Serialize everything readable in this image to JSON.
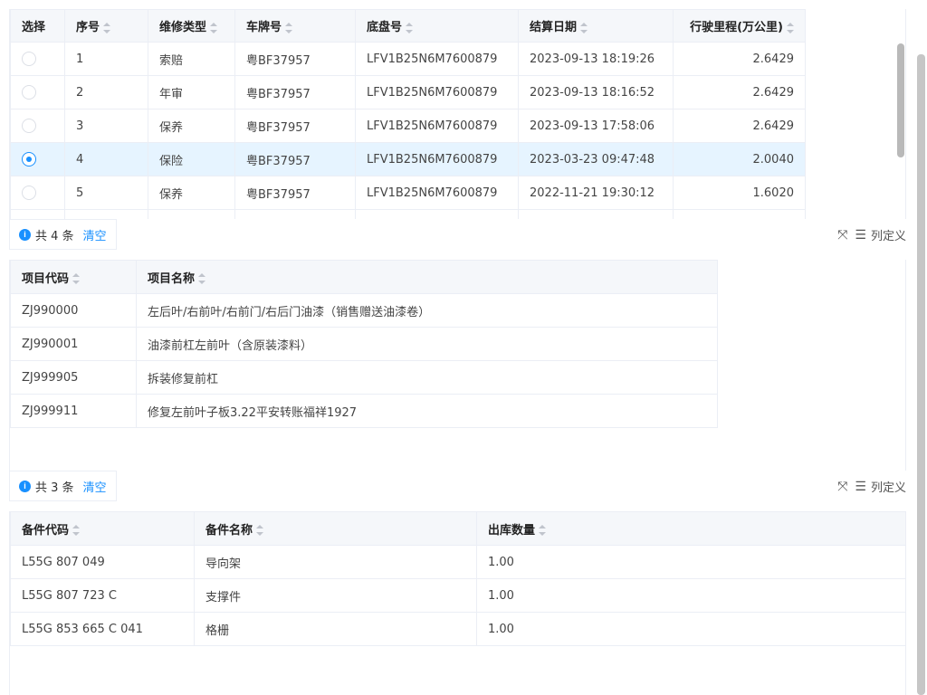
{
  "vehicle_table": {
    "headers": [
      "选择",
      "序号",
      "维修类型",
      "车牌号",
      "底盘号",
      "结算日期",
      "行驶里程(万公里)"
    ],
    "rows": [
      {
        "seq": "1",
        "type": "索赔",
        "plate": "粤BF37957",
        "vin": "LFV1B25N6M7600879",
        "date": "2023-09-13 18:19:26",
        "mileage": "2.6429",
        "selected": false
      },
      {
        "seq": "2",
        "type": "年审",
        "plate": "粤BF37957",
        "vin": "LFV1B25N6M7600879",
        "date": "2023-09-13 18:16:52",
        "mileage": "2.6429",
        "selected": false
      },
      {
        "seq": "3",
        "type": "保养",
        "plate": "粤BF37957",
        "vin": "LFV1B25N6M7600879",
        "date": "2023-09-13 17:58:06",
        "mileage": "2.6429",
        "selected": false
      },
      {
        "seq": "4",
        "type": "保险",
        "plate": "粤BF37957",
        "vin": "LFV1B25N6M7600879",
        "date": "2023-03-23 09:47:48",
        "mileage": "2.0040",
        "selected": true
      },
      {
        "seq": "5",
        "type": "保养",
        "plate": "粤BF37957",
        "vin": "LFV1B25N6M7600879",
        "date": "2022-11-21 19:30:12",
        "mileage": "1.6020",
        "selected": false
      }
    ]
  },
  "toolbar1": {
    "count": "共 4 条",
    "clear": "清空",
    "column_def": "列定义"
  },
  "project_table": {
    "headers": [
      "项目代码",
      "项目名称"
    ],
    "rows": [
      {
        "code": "ZJ990000",
        "name": "左后叶/右前叶/右前门/右后门油漆（销售赠送油漆卷）"
      },
      {
        "code": "ZJ990001",
        "name": "油漆前杠左前叶（含原装漆料）"
      },
      {
        "code": "ZJ999905",
        "name": "拆装修复前杠"
      },
      {
        "code": "ZJ999911",
        "name": "修复左前叶子板3.22平安转账福祥1927"
      }
    ]
  },
  "toolbar2": {
    "count": "共 3 条",
    "clear": "清空",
    "column_def": "列定义"
  },
  "parts_table": {
    "headers": [
      "备件代码",
      "备件名称",
      "出库数量"
    ],
    "rows": [
      {
        "code": "L55G 807 049",
        "name": "导向架",
        "qty": "1.00"
      },
      {
        "code": "L55G 807 723 C",
        "name": "支撑件",
        "qty": "1.00"
      },
      {
        "code": "L55G 853 665 C 041",
        "name": "格栅",
        "qty": "1.00"
      }
    ]
  },
  "colors": {
    "accent": "#1890ff",
    "selected_row": "#e6f4ff",
    "header_bg": "#f5f7fa"
  }
}
